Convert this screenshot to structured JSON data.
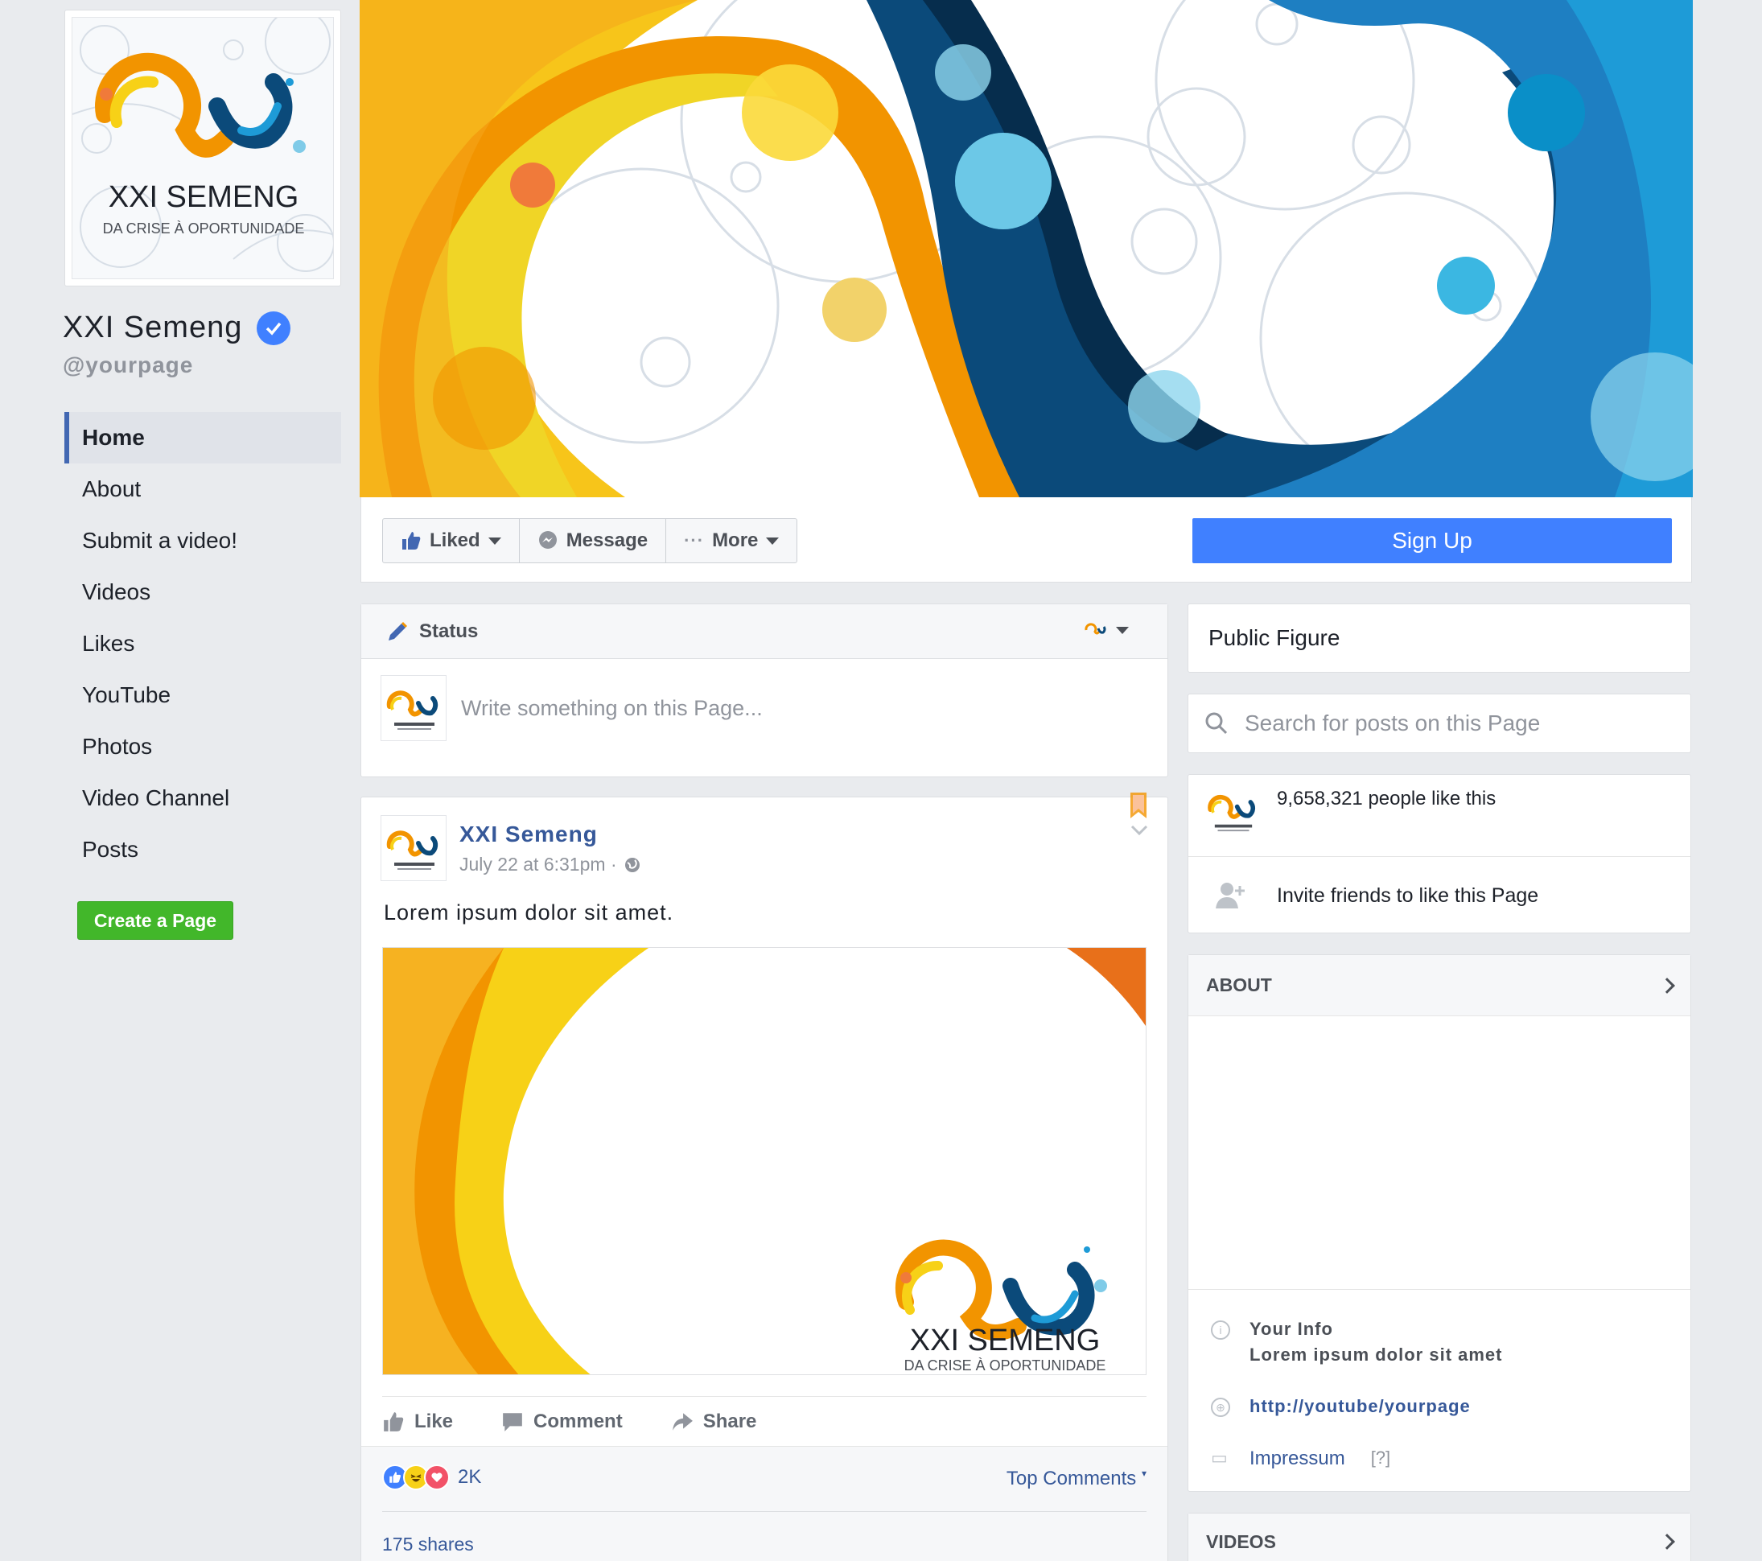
{
  "page": {
    "name": "XXI Semeng",
    "handle": "@yourpage",
    "logo_title": "XXI SEMENG",
    "logo_subtitle": "DA CRISE À OPORTUNIDADE"
  },
  "nav": {
    "items": [
      {
        "label": "Home",
        "active": true
      },
      {
        "label": "About"
      },
      {
        "label": "Submit a video!"
      },
      {
        "label": "Videos"
      },
      {
        "label": "Likes"
      },
      {
        "label": "YouTube"
      },
      {
        "label": "Photos"
      },
      {
        "label": "Video Channel"
      },
      {
        "label": "Posts"
      }
    ],
    "create_page": "Create a Page"
  },
  "actions": {
    "liked": "Liked",
    "message": "Message",
    "more": "More",
    "signup": "Sign Up"
  },
  "composer": {
    "tab": "Status",
    "placeholder": "Write something on this Page..."
  },
  "post": {
    "author": "XXI Semeng",
    "time": "July 22 at 6:31pm ·",
    "text": "Lorem ipsum dolor sit amet.",
    "like": "Like",
    "comment": "Comment",
    "share": "Share",
    "reaction_count": "2K",
    "top_comments": "Top Comments",
    "shares": "175 shares"
  },
  "sidebar": {
    "category": "Public Figure",
    "search_placeholder": "Search for posts on this Page",
    "likes_text": "9,658,321 people like this",
    "invite_text": "Invite friends to like this Page",
    "about_title": "ABOUT",
    "your_info_label": "Your Info",
    "your_info_text": "Lorem ipsum dolor sit amet",
    "website": "http://youtube/yourpage",
    "impressum": "Impressum",
    "impressum_help": "[?]",
    "videos_title": "VIDEOS"
  },
  "colors": {
    "brand_blue": "#4267b2",
    "signup_blue": "#4080ff",
    "create_green": "#42b72a",
    "orange": "#f29400",
    "yellow": "#f7d117",
    "deep_blue": "#0b4a7a"
  }
}
